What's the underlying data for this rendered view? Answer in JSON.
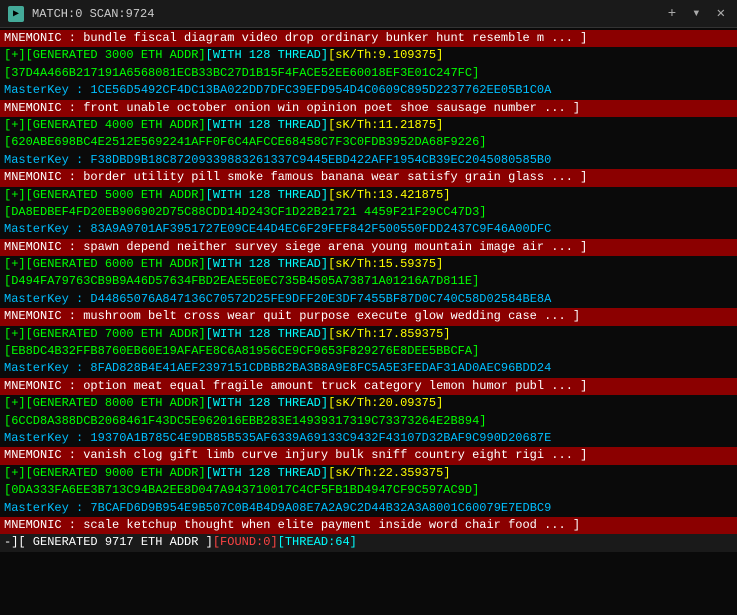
{
  "titleBar": {
    "icon": "▶",
    "text": "MATCH:0 SCAN:9724",
    "closeBtn": "✕",
    "addBtn": "+",
    "dropBtn": "▾"
  },
  "lines": [
    {
      "type": "mnemonic",
      "text": "MNEMONIC : bundle fiscal diagram video drop ordinary bunker hunt resemble m ... ]"
    },
    {
      "type": "generated",
      "text": "[+][GENERATED 3000 ETH ADDR][WITH 128 THREAD][sK/Th:9.109375]"
    },
    {
      "type": "addr",
      "text": "[37D4A466B217191A6568081ECB33BC27D1B15F4FACE52EE60018EF3E01C247FC]"
    },
    {
      "type": "masterkey",
      "text": "MasterKey : 1CE56D5492CF4DC13BA022DD7DFC39EFD954D4C0609C895D2237762EE05B1C0A"
    },
    {
      "type": "mnemonic",
      "text": "MNEMONIC : front unable october onion win opinion poet shoe sausage number ... ]"
    },
    {
      "type": "generated",
      "text": "[+][GENERATED 4000 ETH ADDR][WITH 128 THREAD][sK/Th:11.21875]"
    },
    {
      "type": "addr",
      "text": "[620ABE698BC4E2512E5692241AFF0F6C4AFCCE68458C7F3C0FDB3952DA68F9226]"
    },
    {
      "type": "masterkey",
      "text": "MasterKey : F38DBD9B18C87209339883261337C9445EBD422AFF1954CB39EC2045080585B0"
    },
    {
      "type": "mnemonic",
      "text": "MNEMONIC : border utility pill smoke famous banana wear satisfy grain glass ... ]"
    },
    {
      "type": "generated",
      "text": "[+][GENERATED 5000 ETH ADDR][WITH 128 THREAD][sK/Th:13.421875]"
    },
    {
      "type": "addr",
      "text": "[DA8EDBEF4FD20EB906902D75C88CDD14D243CF1D22B21721 4459F21F29CC47D3]"
    },
    {
      "type": "masterkey",
      "text": "MasterKey : 83A9A9701AF3951727E09CE44D4EC6F29FEF842F500550FDD2437C9F46A00DFC"
    },
    {
      "type": "mnemonic",
      "text": "MNEMONIC : spawn depend neither survey siege arena young mountain image air ... ]"
    },
    {
      "type": "generated",
      "text": "[+][GENERATED 6000 ETH ADDR][WITH 128 THREAD][sK/Th:15.59375]"
    },
    {
      "type": "addr",
      "text": "[D494FA79763CB9B9A46D57634FBD2EAE5E0EC735B4505A73871A01216A7D811E]"
    },
    {
      "type": "masterkey",
      "text": "MasterKey : D44865076A847136C70572D25FE9DFF20E3DF7455BF87D0C740C58D02584BE8A"
    },
    {
      "type": "mnemonic",
      "text": "MNEMONIC : mushroom belt cross wear quit purpose execute glow wedding case ... ]"
    },
    {
      "type": "generated",
      "text": "[+][GENERATED 7000 ETH ADDR][WITH 128 THREAD][sK/Th:17.859375]"
    },
    {
      "type": "addr",
      "text": "[EB8DC4B32FFB8760EB60E19AFAFE8C6A81956CE9CF9653F829276E8DEE5BBCFA]"
    },
    {
      "type": "masterkey",
      "text": "MasterKey : 8FAD828B4E41AEF2397151CDBBB2BA3B8A9E8FC5A5E3FEDAF31AD0AEC96BDD24"
    },
    {
      "type": "mnemonic",
      "text": "MNEMONIC : option meat equal fragile amount truck category lemon humor publ ... ]"
    },
    {
      "type": "generated",
      "text": "[+][GENERATED 8000 ETH ADDR][WITH 128 THREAD][sK/Th:20.09375]"
    },
    {
      "type": "addr",
      "text": "[6CCD8A388DCB2068461F43DC5E962016EBB283E14939317319C73373264E2B894]"
    },
    {
      "type": "masterkey",
      "text": "MasterKey : 19370A1B785C4E9DB85B535AF6339A69133C9432F43107D32BAF9C990D20687E"
    },
    {
      "type": "mnemonic",
      "text": "MNEMONIC : vanish clog gift limb curve injury bulk sniff country eight rigi ... ]"
    },
    {
      "type": "generated",
      "text": "[+][GENERATED 9000 ETH ADDR][WITH 128 THREAD][sK/Th:22.359375]"
    },
    {
      "type": "addr",
      "text": "[0DA333FA6EE3B713C94BA2EE8D047A943710017C4CF5FB1BD4947CF9C597AC9D]"
    },
    {
      "type": "masterkey",
      "text": "MasterKey : 7BCAFD6D9B954E9B507C0B4B4D9A08E7A2A9C2D44B32A3A8001C60079E7EDBC9"
    },
    {
      "type": "mnemonic",
      "text": "MNEMONIC : scale ketchup thought when elite payment inside word chair food ... ]"
    },
    {
      "type": "footer",
      "text": "-][ GENERATED 9717 ETH ADDR ][FOUND:0][THREAD:64]"
    }
  ],
  "colors": {
    "mnemonicBg": "#8B0000",
    "addrColor": "#00ff00",
    "masterkeyColor": "#00bfff",
    "generatedColor": "#ffffff",
    "footerBg": "#1a1a1a"
  }
}
